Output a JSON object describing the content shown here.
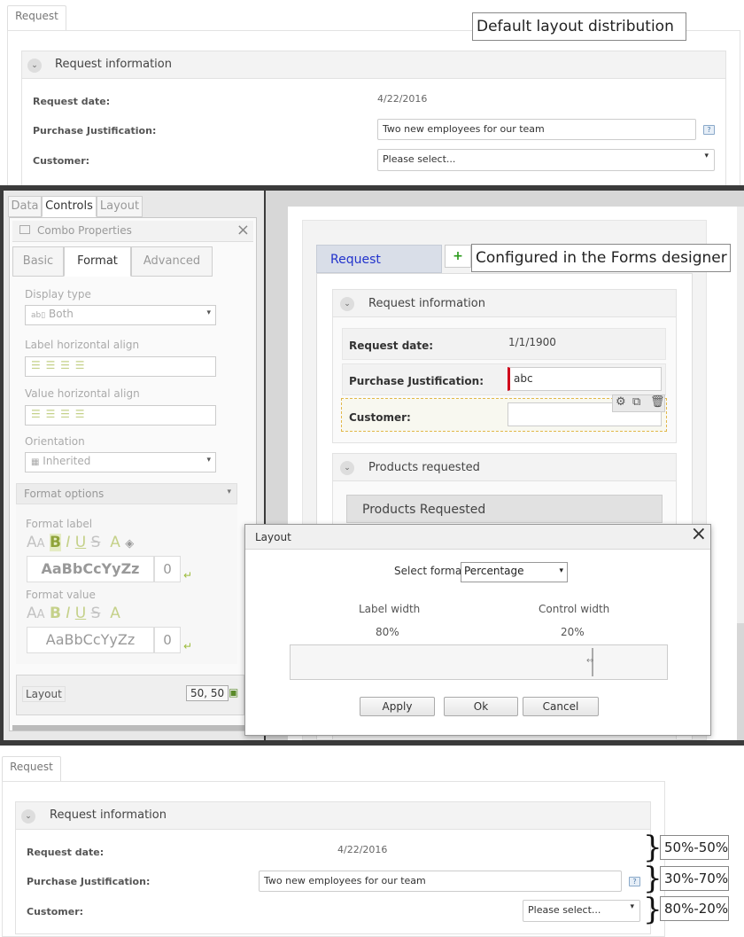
{
  "callouts": {
    "default_layout": "Default layout distribution",
    "configured": "Configured in the Forms designer",
    "ratio_1": "50%-50%",
    "ratio_2": "30%-70%",
    "ratio_3": "80%-20%"
  },
  "top_form": {
    "tab": "Request",
    "section": "Request information",
    "fields": [
      {
        "label": "Request date:",
        "value": "4/22/2016"
      },
      {
        "label": "Purchase Justification:",
        "value": "Two new employees for our team"
      },
      {
        "label": "Customer:",
        "value": "Please select..."
      }
    ],
    "help_icon": "?"
  },
  "designer": {
    "panel_tabs": [
      "Data",
      "Controls",
      "Layout"
    ],
    "properties_title": "Combo Properties",
    "prop_tabs": [
      "Basic",
      "Format",
      "Advanced"
    ],
    "display_type_label": "Display type",
    "display_type_value": "Both",
    "label_halign": "Label horizontal align",
    "value_halign": "Value horizontal align",
    "orientation_label": "Orientation",
    "orientation_value": "Inherited",
    "format_options": "Format options",
    "format_label": "Format label",
    "format_value": "Format value",
    "font_buttons": [
      "A",
      "A",
      "B",
      "I",
      "U",
      "S",
      "A"
    ],
    "sample_label": "AaBbCcYyZz",
    "sample_label_size": "0",
    "sample_value": "AaBbCcYyZz",
    "sample_value_size": "0",
    "layout_label": "Layout",
    "layout_value": "50, 50",
    "canvas_tab": "Request",
    "plus": "+",
    "section1": "Request information",
    "fields": [
      {
        "label": "Request date:",
        "value": "1/1/1900"
      },
      {
        "label": "Purchase Justification:",
        "value": "abc"
      },
      {
        "label": "Customer:",
        "value": ""
      }
    ],
    "section2": "Products requested",
    "grid_title": "Products Requested"
  },
  "layout_dialog": {
    "title": "Layout",
    "select_format_label": "Select format",
    "select_format_value": "Percentage",
    "label_width_label": "Label width",
    "control_width_label": "Control width",
    "label_width_value": "80%",
    "control_width_value": "20%",
    "split_fraction": 0.8,
    "apply": "Apply",
    "ok": "Ok",
    "cancel": "Cancel"
  },
  "bottom_form": {
    "tab": "Request",
    "section": "Request information",
    "fields": [
      {
        "label": "Request date:",
        "value": "4/22/2016"
      },
      {
        "label": "Purchase Justification:",
        "value": "Two new employees for our team"
      },
      {
        "label": "Customer:",
        "value": "Please select..."
      }
    ],
    "help_icon": "?"
  }
}
